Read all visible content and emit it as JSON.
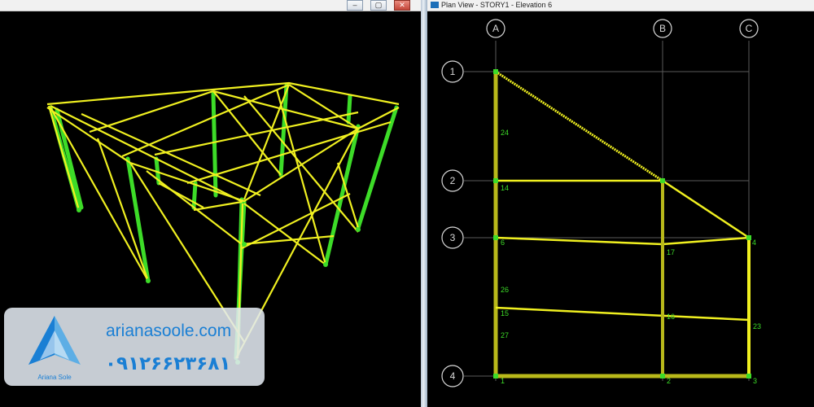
{
  "plan_window": {
    "title": "Plan View - STORY1 - Elevation 6",
    "grid_columns": [
      "A",
      "B",
      "C"
    ],
    "grid_rows": [
      "1",
      "2",
      "3",
      "4"
    ],
    "member_labels": [
      "24",
      "14",
      "6",
      "17",
      "4",
      "26",
      "15",
      "16",
      "23",
      "27",
      "1",
      "2",
      "3"
    ]
  },
  "window_controls": {
    "minimize": "–",
    "maximize": "▢",
    "close": "✕"
  },
  "watermark": {
    "website": "arianasoole.com",
    "phone": "۰۹۱۲۶۶۲۳۶۸۱",
    "logo_text": "Ariana Sole"
  },
  "colors": {
    "beam": "#f0f020",
    "column": "#3ddc28",
    "grid_line": "#5a5a5a",
    "label": "#3ddc28",
    "bubble": "#d8d8d8",
    "brand": "#1a7fd4"
  }
}
